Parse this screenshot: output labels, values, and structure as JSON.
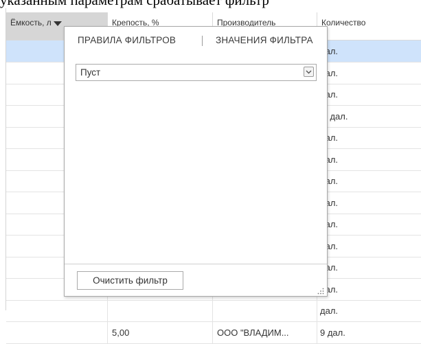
{
  "document_text": "указанным параметрам срабатывает фильтр",
  "table": {
    "columns": [
      {
        "label": "Ёмкость, л",
        "filtered": true
      },
      {
        "label": "Крепость, %",
        "filtered": false
      },
      {
        "label": "Производитель",
        "filtered": false
      },
      {
        "label": "Количество",
        "filtered": false
      }
    ],
    "rows": [
      {
        "capacity": "",
        "strength": "",
        "producer": "",
        "quantity": "дал."
      },
      {
        "capacity": "",
        "strength": "",
        "producer": "",
        "quantity": "дал."
      },
      {
        "capacity": "",
        "strength": "",
        "producer": "",
        "quantity": "дал."
      },
      {
        "capacity": "",
        "strength": "",
        "producer": "",
        "quantity": ",3 дал."
      },
      {
        "capacity": "",
        "strength": "",
        "producer": "",
        "quantity": "дал."
      },
      {
        "capacity": "",
        "strength": "",
        "producer": "",
        "quantity": "дал."
      },
      {
        "capacity": "",
        "strength": "",
        "producer": "",
        "quantity": "дал."
      },
      {
        "capacity": "",
        "strength": "",
        "producer": "",
        "quantity": "дал."
      },
      {
        "capacity": "",
        "strength": "",
        "producer": "",
        "quantity": "дал."
      },
      {
        "capacity": "",
        "strength": "",
        "producer": "",
        "quantity": "дал."
      },
      {
        "capacity": "",
        "strength": "",
        "producer": "",
        "quantity": "дал."
      },
      {
        "capacity": "",
        "strength": "",
        "producer": "",
        "quantity": "дал."
      },
      {
        "capacity": "",
        "strength": "",
        "producer": "",
        "quantity": "дал."
      },
      {
        "capacity": "",
        "strength": "5,00",
        "producer": "ООО \"ВЛАДИМ...",
        "quantity": "9 дал."
      }
    ]
  },
  "filter_popup": {
    "tabs": [
      "ПРАВИЛА ФИЛЬТРОВ",
      "ЗНАЧЕНИЯ ФИЛЬТРА"
    ],
    "active_tab": 0,
    "condition_value": "Пуст",
    "clear_button_label": "Очистить фильтр"
  },
  "colors": {
    "selected_row": "#cfe3fb",
    "filtered_header": "#d6d6d6"
  }
}
